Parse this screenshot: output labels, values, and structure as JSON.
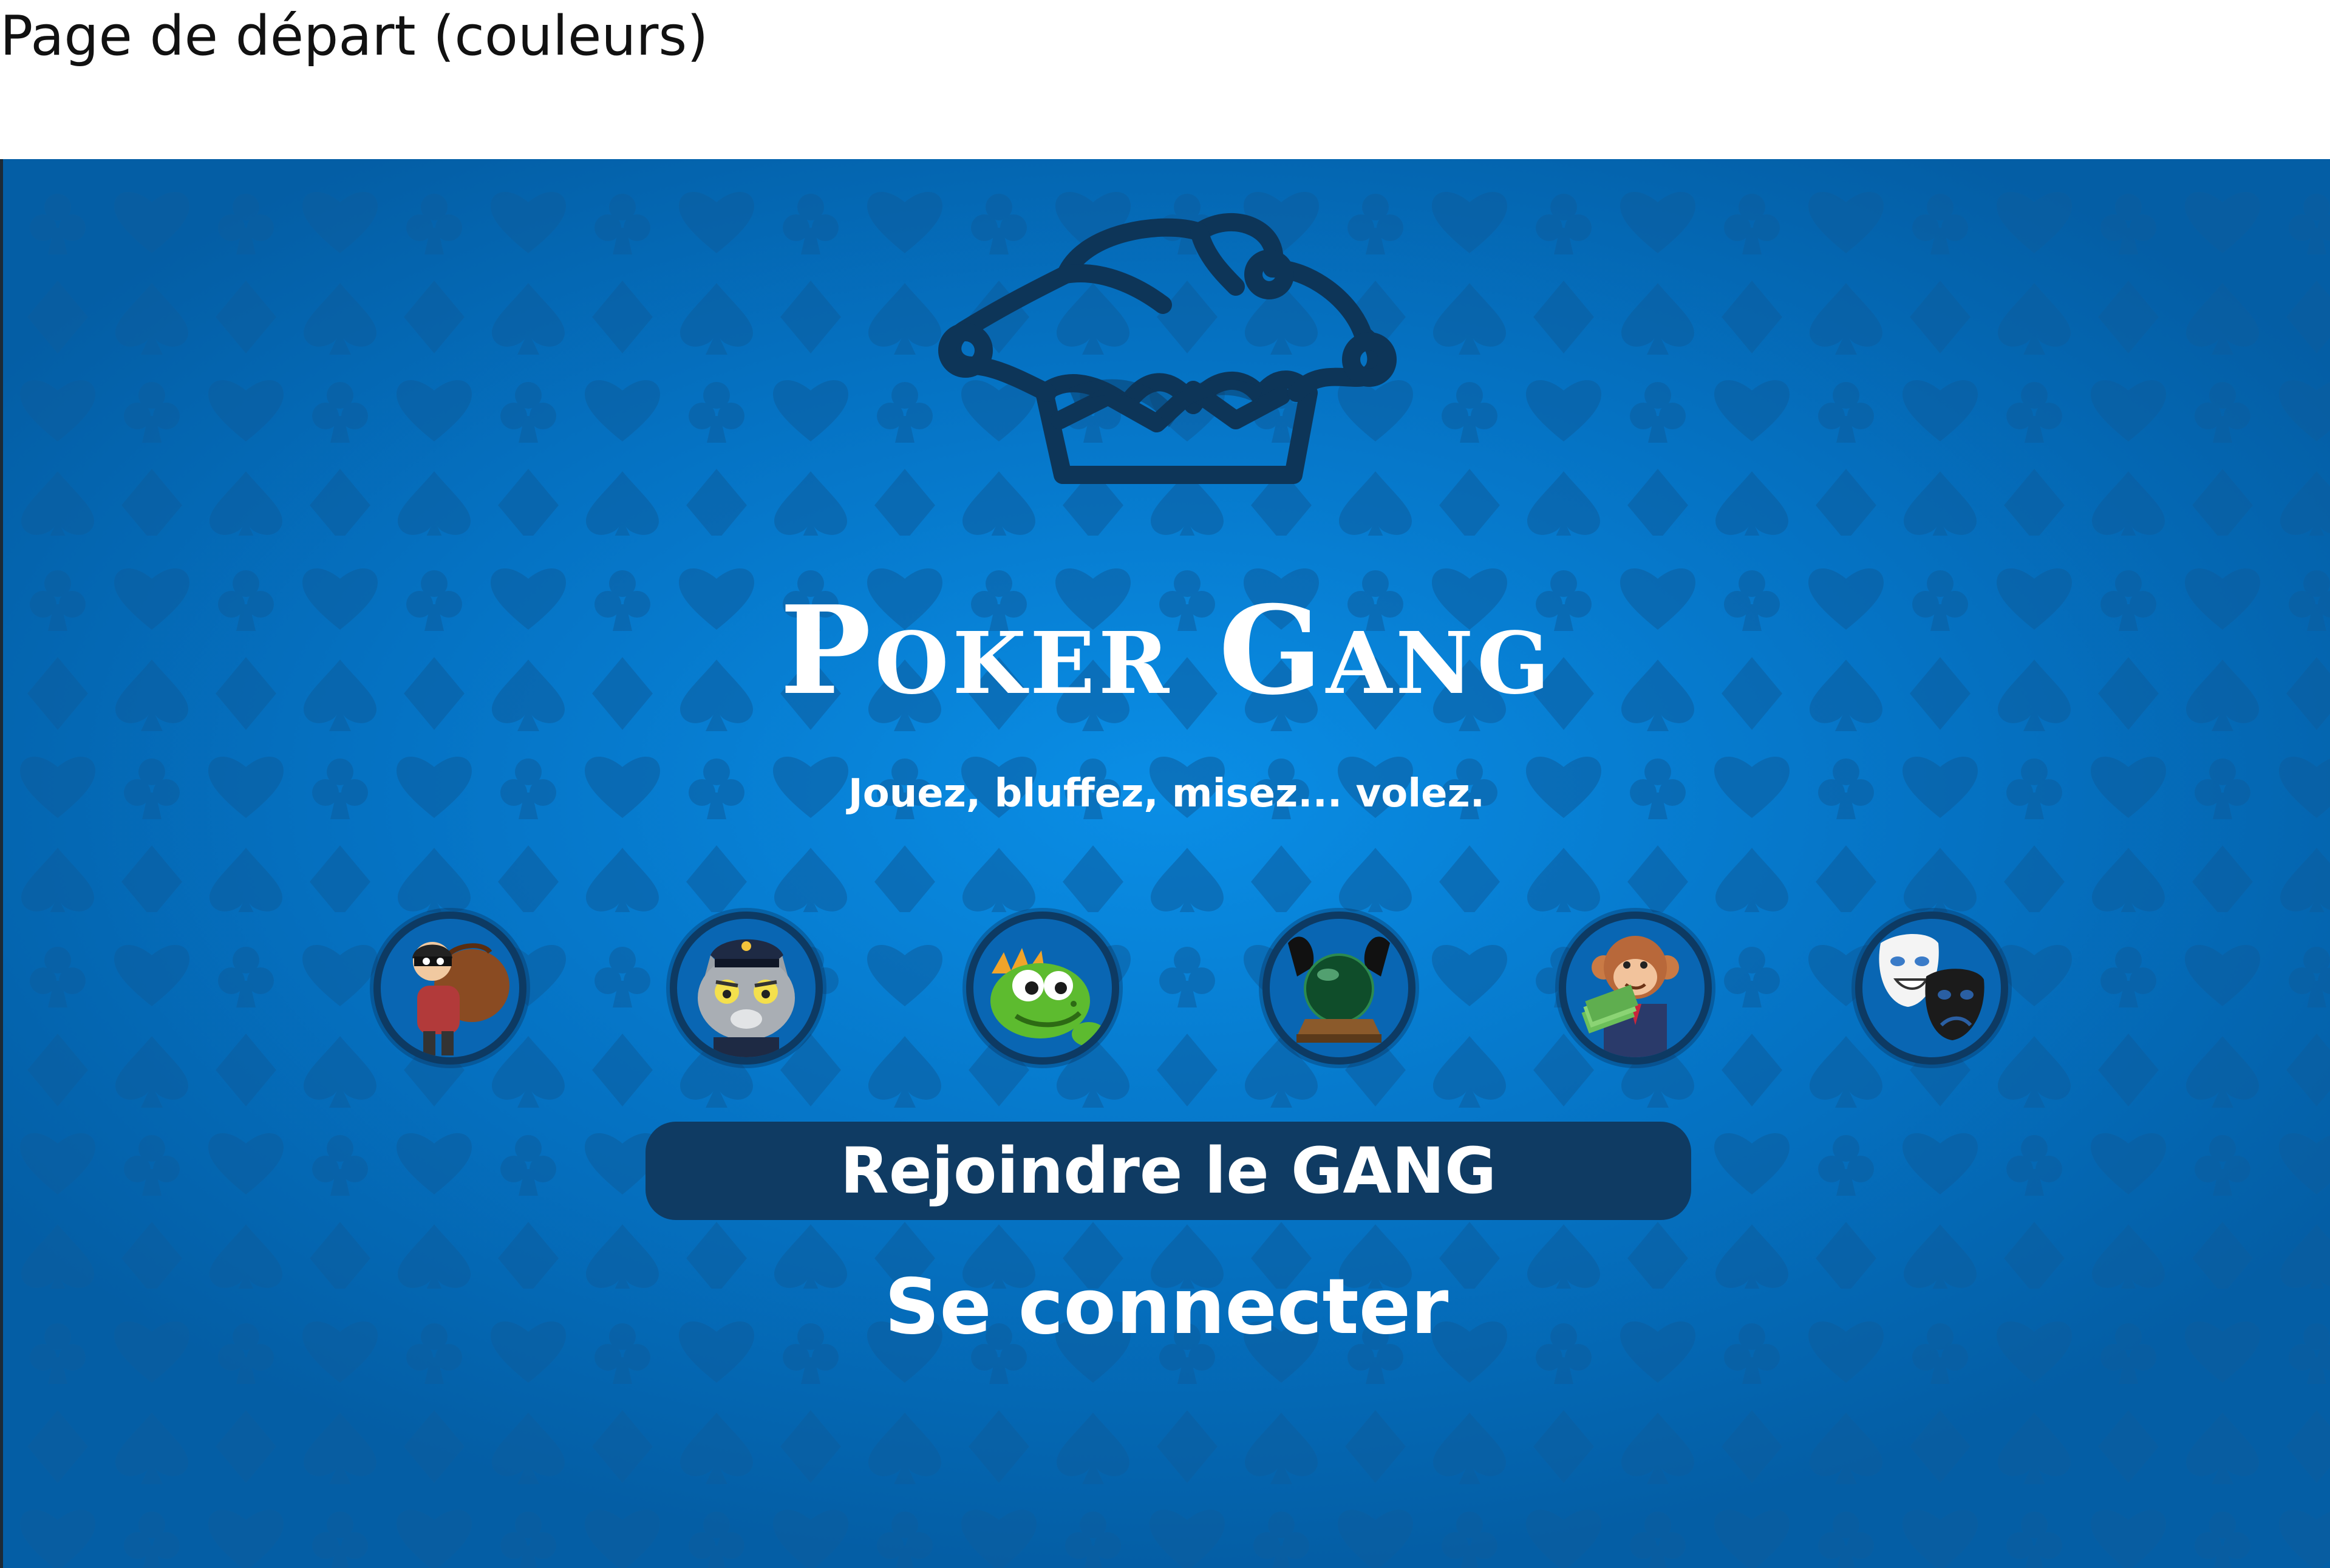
{
  "page_caption": "Page de départ (couleurs)",
  "app": {
    "title": "Poker Gang",
    "tagline": "Jouez, bluffez, misez... volez.",
    "logo_icon": "jester-hat-icon"
  },
  "avatars": [
    {
      "name": "thief-with-sack-avatar"
    },
    {
      "name": "police-cat-avatar"
    },
    {
      "name": "green-dinosaur-avatar"
    },
    {
      "name": "crystal-ball-avatar"
    },
    {
      "name": "monkey-with-money-avatar"
    },
    {
      "name": "theater-masks-avatar"
    }
  ],
  "actions": {
    "join_label": "Rejoindre le GANG",
    "login_label": "Se connecter"
  },
  "colors": {
    "background": "#0573c4",
    "pattern": "#0a5d9e",
    "button": "#0f3b63",
    "logo_stroke": "#0d3558",
    "text": "#ffffff"
  }
}
